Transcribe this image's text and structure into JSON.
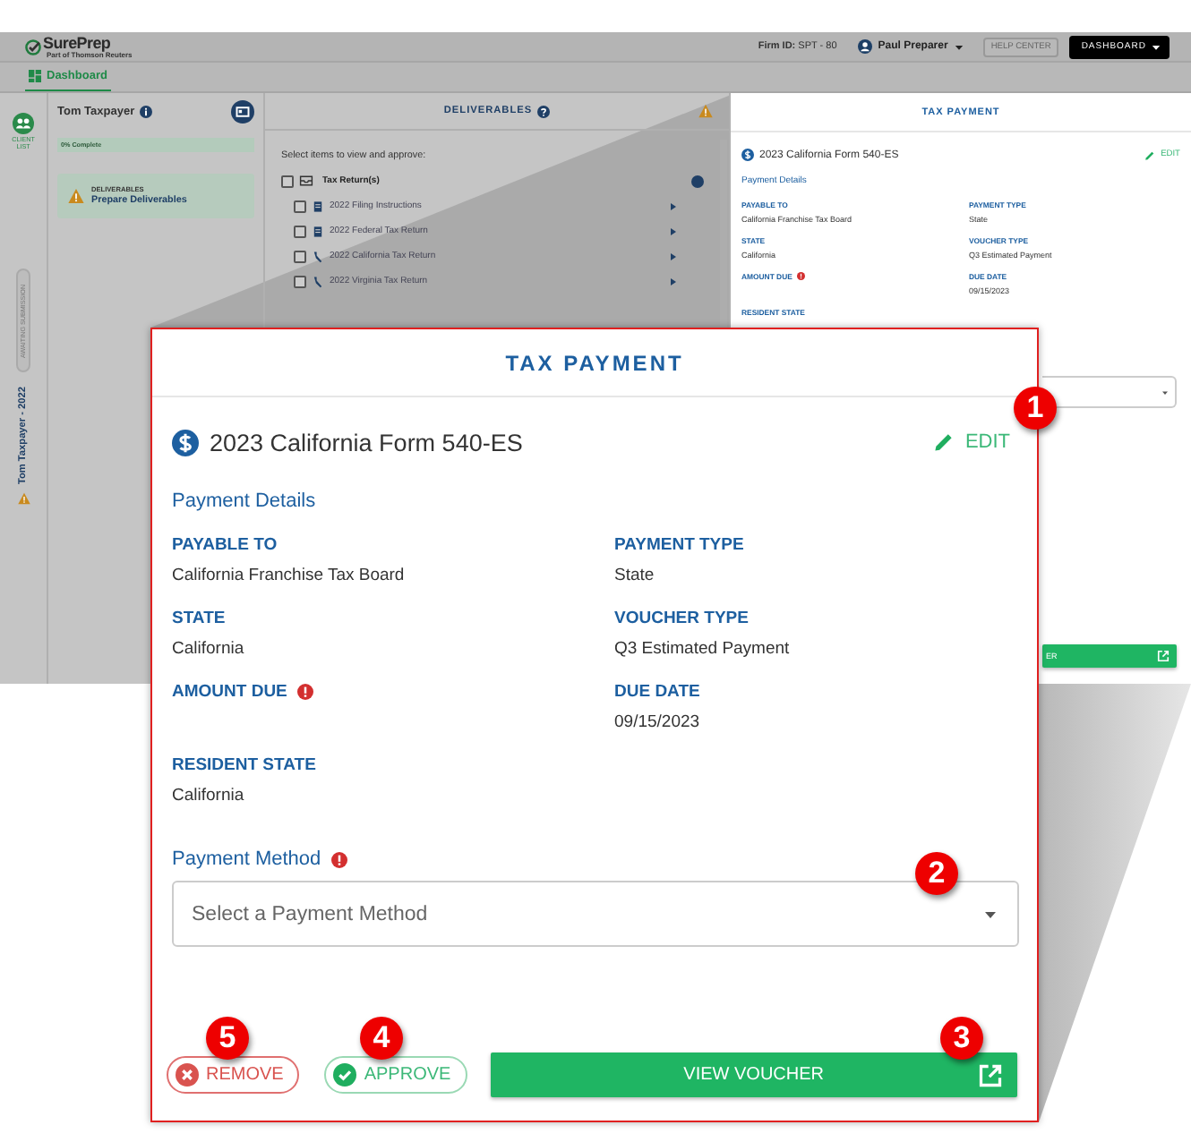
{
  "header": {
    "logo": "SurePrep",
    "logo_tagline": "Part of Thomson Reuters",
    "firm_label": "Firm ID:",
    "firm_id": "SPT - 80",
    "user": "Paul Preparer",
    "help_button": "HELP CENTER",
    "dashboard_button": "DASHBOARD"
  },
  "nav_tabs": [
    {
      "label": "Dashboard",
      "selected": true
    }
  ],
  "rail": {
    "client_list": "CLIENT LIST",
    "status": "AWAITING SUBMISSION",
    "client_year": "Tom Taxpayer - 2022"
  },
  "client": {
    "name": "Tom Taxpayer",
    "progress_label": "0% Complete",
    "level": 0,
    "task_title": "DELIVERABLES",
    "task_link": "Prepare Deliverables"
  },
  "deliverables": {
    "title": "DELIVERABLES",
    "instruction": "Select items to view and approve:",
    "group": {
      "label": "Tax Return(s)",
      "checked": false
    },
    "items": [
      {
        "label": "2022 Filing Instructions",
        "checked": false,
        "kind": "document"
      },
      {
        "label": "2022 Federal Tax Return",
        "checked": false,
        "kind": "document"
      },
      {
        "label": "2022 California Tax Return",
        "checked": false,
        "kind": "state"
      },
      {
        "label": "2022 Virginia Tax Return",
        "checked": false,
        "kind": "state"
      }
    ]
  },
  "panel": {
    "title": "TAX PAYMENT",
    "form": "2023 California Form 540-ES",
    "edit": "EDIT",
    "section": "Payment Details",
    "fields": [
      {
        "label": "PAYABLE TO",
        "value": "California Franchise Tax Board",
        "required": false
      },
      {
        "label": "PAYMENT TYPE",
        "value": "State",
        "required": false
      },
      {
        "label": "STATE",
        "value": "California",
        "required": false
      },
      {
        "label": "VOUCHER TYPE",
        "value": "Q3 Estimated Payment",
        "required": false
      },
      {
        "label": "AMOUNT DUE",
        "required": true
      },
      {
        "label": "DUE DATE",
        "value": "09/15/2023",
        "required": false
      },
      {
        "label": "RESIDENT STATE",
        "required": false
      }
    ],
    "button_fragment": "ER"
  },
  "callout": {
    "title": "TAX PAYMENT",
    "form": "2023 California Form 540-ES",
    "edit": "EDIT",
    "section": "Payment Details",
    "fields": [
      {
        "label": "PAYABLE TO",
        "value": "California Franchise Tax Board",
        "required": false
      },
      {
        "label": "PAYMENT TYPE",
        "value": "State",
        "required": false
      },
      {
        "label": "STATE",
        "value": "California",
        "required": false
      },
      {
        "label": "VOUCHER TYPE",
        "value": "Q3 Estimated Payment",
        "required": false
      },
      {
        "label": "AMOUNT DUE",
        "required": true
      },
      {
        "label": "DUE DATE",
        "value": "09/15/2023",
        "required": false
      },
      {
        "label": "RESIDENT STATE",
        "value": "California",
        "required": false
      }
    ],
    "method_label": "Payment Method",
    "method_required": true,
    "method_placeholder": "Select a Payment Method",
    "remove_button": "REMOVE",
    "approve_button": "APPROVE",
    "view_button": "VIEW VOUCHER"
  },
  "markers": [
    {
      "number": "1"
    },
    {
      "number": "2"
    },
    {
      "number": "5"
    },
    {
      "number": "4"
    },
    {
      "number": "3"
    }
  ]
}
